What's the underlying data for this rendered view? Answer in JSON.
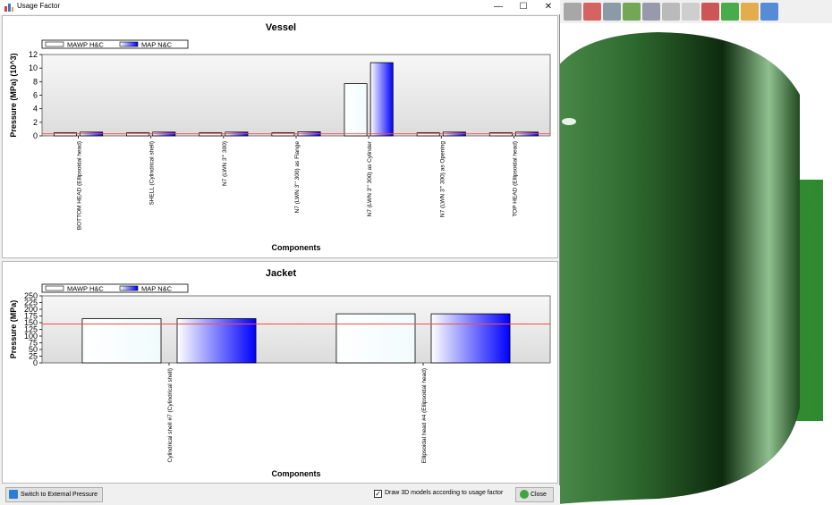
{
  "window": {
    "title": "Usage Factor",
    "minimize": "—",
    "maximize": "☐",
    "close": "✕"
  },
  "legend": {
    "series_a": "MAWP H&C",
    "series_b": "MAP N&C"
  },
  "footer": {
    "external_button": "Switch to External Pressure",
    "draw_checkbox_label": "Draw 3D models according to usage factor",
    "draw_checkbox_checked": true,
    "close_button": "Close"
  },
  "toolbar_icons": [
    "wrench-icon",
    "thermometer-icon",
    "books-icon",
    "layers-icon",
    "document-icon",
    "vessel-head-icon",
    "vessel-shell-icon",
    "nozzle-chain-icon",
    "pulse-chart-icon",
    "report-icon",
    "bar-chart-icon"
  ],
  "colors": {
    "series_a_fill": "#f0fbfd",
    "series_b_fill": "#0000ff",
    "limit_line": "#ff4a4a",
    "plot_bg": "#e6e6e6"
  },
  "chart_data": [
    {
      "type": "bar",
      "title": "Vessel",
      "xlabel": "Components",
      "ylabel": "Pressure (MPa) (10^3)",
      "ylim": [
        0,
        12
      ],
      "yticks": [
        "0",
        "2",
        "4",
        "6",
        "8",
        "10",
        "12"
      ],
      "categories": [
        "BOTTOM HEAD (Ellipsoidal head)",
        "SHELL (Cylindrical shell)",
        "N7 (LWN 3\"' 300)",
        "N7 (LWN 3\"' 300) as Flange",
        "N7 (LWN 3\"' 300) as Cylinder",
        "N7 (LWN 3\"' 300) as Opening",
        "TOP HEAD (Ellipsoidal head)"
      ],
      "series": [
        {
          "name": "MAWP H&C",
          "values": [
            0.45,
            0.45,
            0.45,
            0.45,
            7.7,
            0.45,
            0.45
          ]
        },
        {
          "name": "MAP N&C",
          "values": [
            0.55,
            0.55,
            0.55,
            0.6,
            10.8,
            0.55,
            0.55
          ]
        }
      ],
      "reference_line": 0.3,
      "legend": "top-left"
    },
    {
      "type": "bar",
      "title": "Jacket",
      "xlabel": "Components",
      "ylabel": "Pressure (MPa)",
      "ylim": [
        0,
        250
      ],
      "yticks": [
        "0",
        "25",
        "50",
        "75",
        "100",
        "125",
        "150",
        "175",
        "200",
        "225",
        "250"
      ],
      "categories": [
        "Cylindrical shell #7 (Cylindrical shell)",
        "Ellipsoidal head #4 (Ellipsoidal head)"
      ],
      "series": [
        {
          "name": "MAWP H&C",
          "values": [
            165,
            183
          ]
        },
        {
          "name": "MAP N&C",
          "values": [
            165,
            183
          ]
        }
      ],
      "reference_line": 145,
      "legend": "top-left"
    }
  ]
}
